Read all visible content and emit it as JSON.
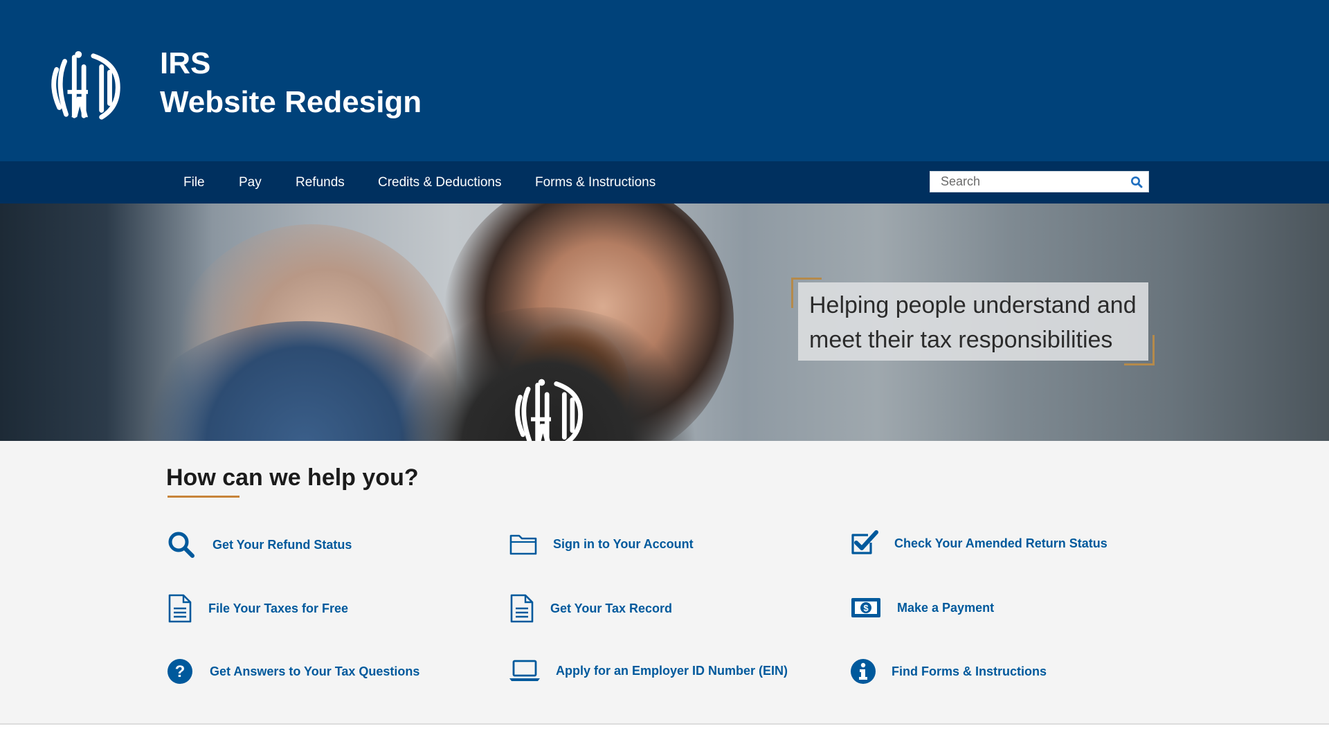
{
  "header": {
    "title_line1": "IRS",
    "title_line2": "Website Redesign"
  },
  "nav": {
    "items": [
      {
        "label": "File"
      },
      {
        "label": "Pay"
      },
      {
        "label": "Refunds"
      },
      {
        "label": "Credits & Deductions"
      },
      {
        "label": "Forms & Instructions"
      }
    ],
    "search_placeholder": "Search"
  },
  "hero": {
    "quote_line1": "Helping people understand and",
    "quote_line2": "meet their tax responsibilities"
  },
  "help": {
    "title": "How can we help you?",
    "links": [
      {
        "label": "Get Your Refund Status",
        "icon": "magnifier-icon"
      },
      {
        "label": "Sign in to Your Account",
        "icon": "folder-icon"
      },
      {
        "label": "Check Your Amended Return Status",
        "icon": "checkbox-check-icon"
      },
      {
        "label": "File Your Taxes for Free",
        "icon": "document-icon"
      },
      {
        "label": "Get Your Tax Record",
        "icon": "document-icon"
      },
      {
        "label": "Make a Payment",
        "icon": "dollar-bill-icon"
      },
      {
        "label": "Get Answers to Your Tax Questions",
        "icon": "question-circle-icon"
      },
      {
        "label": "Apply for an Employer ID Number (EIN)",
        "icon": "laptop-icon"
      },
      {
        "label": "Find Forms & Instructions",
        "icon": "info-circle-icon"
      }
    ]
  },
  "colors": {
    "header_bg": "#00427a",
    "nav_bg": "#00305f",
    "link_blue": "#00599c",
    "accent_gold": "#c7843a",
    "section_bg": "#f4f4f4"
  }
}
